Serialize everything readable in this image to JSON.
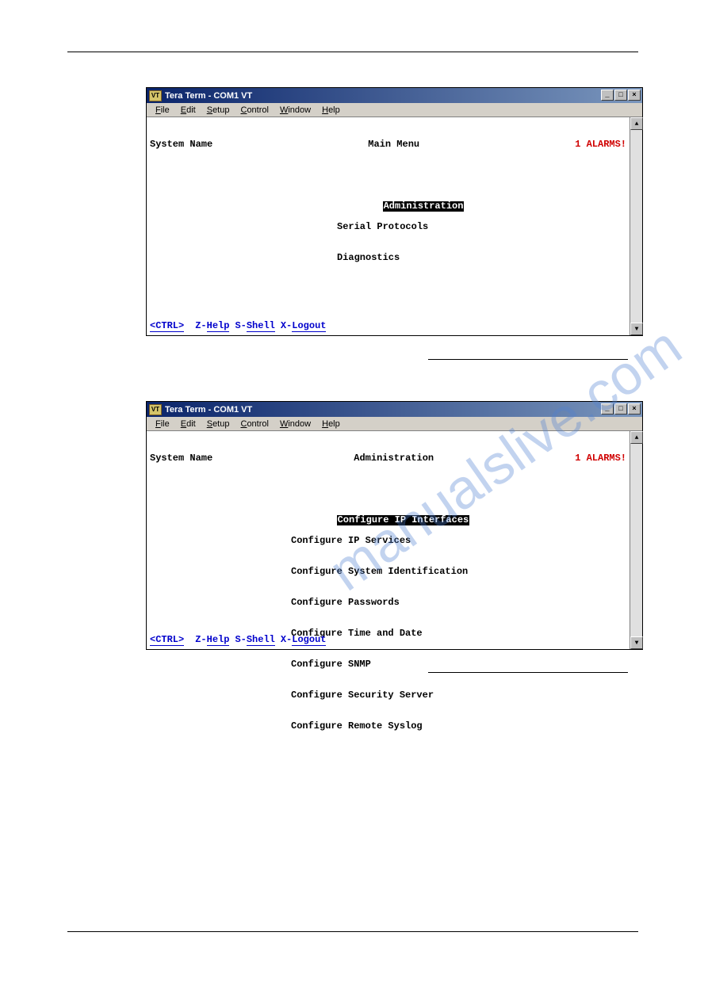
{
  "page": {
    "watermark": "manualslive.com"
  },
  "window1": {
    "title": "Tera Term - COM1 VT",
    "menus": [
      "File",
      "Edit",
      "Setup",
      "Control",
      "Window",
      "Help"
    ],
    "header_left": "System Name",
    "header_center": "Main Menu",
    "header_right": "1 ALARMS!",
    "items": [
      {
        "label": "Administration",
        "selected": true
      },
      {
        "label": "Serial Protocols",
        "selected": false
      },
      {
        "label": "Diagnostics",
        "selected": false
      }
    ],
    "footer": {
      "ctrl": "<CTRL>",
      "help": "Z-Help",
      "shell": "S-Shell",
      "logout": "X-Logout"
    }
  },
  "window2": {
    "title": "Tera Term - COM1 VT",
    "menus": [
      "File",
      "Edit",
      "Setup",
      "Control",
      "Window",
      "Help"
    ],
    "header_left": "System Name",
    "header_center": "Administration",
    "header_right": "1 ALARMS!",
    "items": [
      {
        "label": "Configure IP Interfaces",
        "selected": true
      },
      {
        "label": "Configure IP Services",
        "selected": false
      },
      {
        "label": "Configure System Identification",
        "selected": false
      },
      {
        "label": "Configure Passwords",
        "selected": false
      },
      {
        "label": "Configure Time and Date",
        "selected": false
      },
      {
        "label": "Configure SNMP",
        "selected": false
      },
      {
        "label": "Configure Security Server",
        "selected": false
      },
      {
        "label": "Configure Remote Syslog",
        "selected": false
      }
    ],
    "footer": {
      "ctrl": "<CTRL>",
      "help": "Z-Help",
      "shell": "S-Shell",
      "logout": "X-Logout"
    }
  }
}
